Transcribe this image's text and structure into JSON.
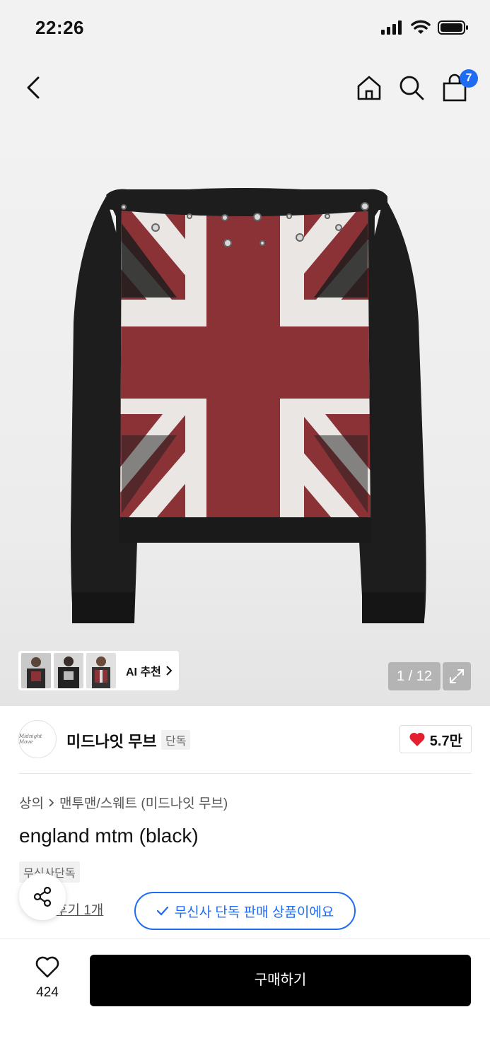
{
  "status": {
    "time": "22:26"
  },
  "nav": {
    "cart_count": "7"
  },
  "gallery": {
    "ai_label": "AI 추천",
    "counter": "1 / 12"
  },
  "brand": {
    "logo_text": "Midnight Move",
    "name": "미드나잇 무브",
    "tag": "단독",
    "likes": "5.7만"
  },
  "product": {
    "breadcrumb": [
      "상의",
      "맨투맨/스웨트 (미드나잇 무브)"
    ],
    "title": "england mtm (black)",
    "exclusive_tag": "무신사단독",
    "review_link": "후기 1개",
    "exclusive_badge": "무신사 단독 판매 상품이에요"
  },
  "bottom": {
    "wish_count": "424",
    "buy_label": "구매하기"
  },
  "colors": {
    "accent": "#1e6cf2",
    "heart": "#e4202f"
  }
}
